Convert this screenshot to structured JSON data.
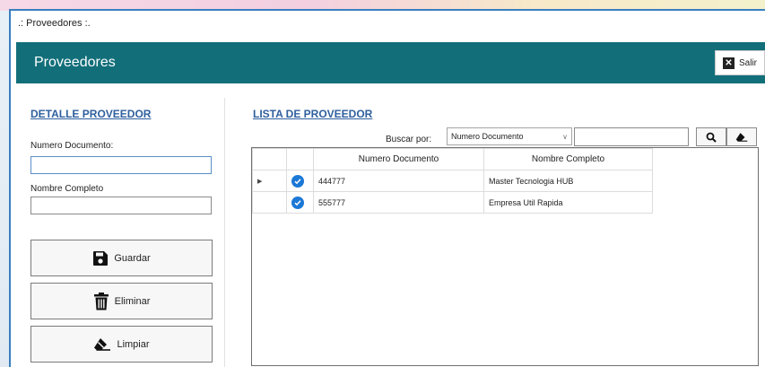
{
  "window": {
    "title": ".: Proveedores :."
  },
  "header": {
    "title": "Proveedores",
    "exit_label": "Salir"
  },
  "detail": {
    "heading": "DETALLE PROVEEDOR",
    "doc_label": "Numero Documento:",
    "doc_value": "",
    "name_label": "Nombre Completo",
    "name_value": "",
    "buttons": {
      "save": "Guardar",
      "delete": "Eliminar",
      "clear": "Limpiar"
    }
  },
  "list": {
    "heading": "LISTA DE PROVEEDOR",
    "search_by_label": "Buscar por:",
    "search_by_selected": "Numero Documento",
    "search_value": "",
    "columns": [
      "Numero Documento",
      "Nombre Completo"
    ],
    "rows": [
      {
        "doc": "444777",
        "name": "Master Tecnologia HUB",
        "selected": true
      },
      {
        "doc": "555777",
        "name": "Empresa Util Rapida",
        "selected": false
      }
    ]
  },
  "icons": {
    "exit": "close-box-icon",
    "save": "floppy-disk-icon",
    "delete": "trash-icon",
    "clear": "eraser-icon",
    "search": "magnifier-icon",
    "erase": "eraser-icon",
    "row_check": "check-circle-icon",
    "row_pointer": "row-pointer-icon"
  },
  "colors": {
    "header": "#126f7a",
    "heading_text": "#2e5f9e",
    "check": "#1c78d6",
    "window_border": "#3a7fc0"
  }
}
